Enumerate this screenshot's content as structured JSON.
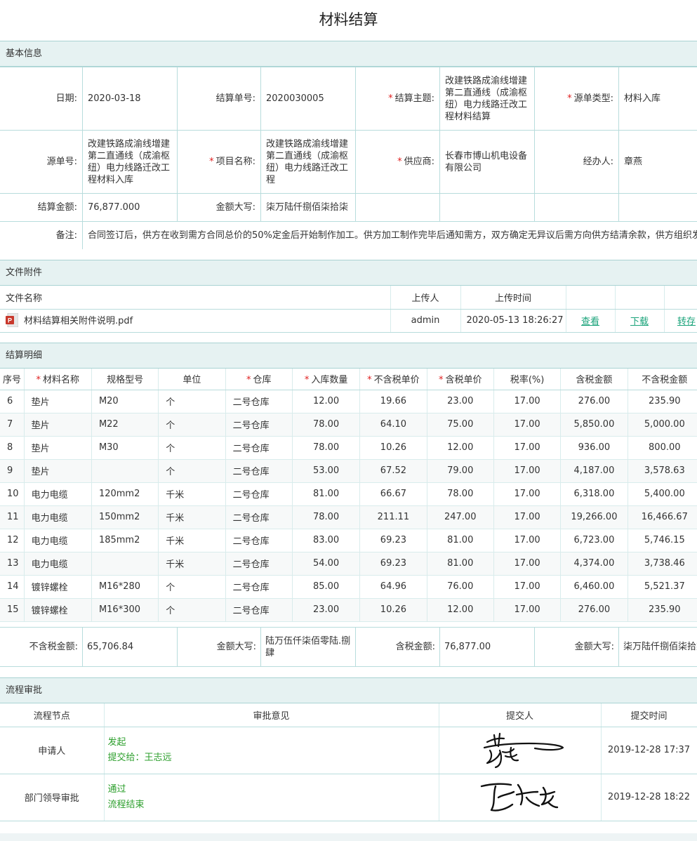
{
  "page": {
    "title": "材料结算"
  },
  "basic": {
    "header": "基本信息",
    "date_label": "日期:",
    "date": "2020-03-18",
    "no_label": "结算单号:",
    "no": "2020030005",
    "subject_label": "结算主题:",
    "subject": "改建铁路成渝线增建第二直通线（成渝枢纽）电力线路迁改工程材料结算",
    "source_type_label": "源单类型:",
    "source_type": "材料入库",
    "source_no_label": "源单号:",
    "source_no": "改建铁路成渝线增建第二直通线（成渝枢纽）电力线路迁改工程材料入库",
    "project_label": "项目名称:",
    "project": "改建铁路成渝线增建第二直通线（成渝枢纽）电力线路迁改工程",
    "supplier_label": "供应商:",
    "supplier": "长春市博山机电设备有限公司",
    "handler_label": "经办人:",
    "handler": "章燕",
    "amount_label": "结算金额:",
    "amount": "76,877.000",
    "amount_cn_label": "金额大写:",
    "amount_cn": "柒万陆仟捌佰柒拾柒",
    "remark_label": "备注:",
    "remark": "合同签订后，供方在收到需方合同总价的50%定金后开始制作加工。供方加工制作完毕后通知需方，双方确定无异议后需方向供方结清余款，供方组织发货"
  },
  "attachments": {
    "header": "文件附件",
    "col_name": "文件名称",
    "col_uploader": "上传人",
    "col_time": "上传时间",
    "file_name": "材料结算相关附件说明.pdf",
    "uploader": "admin",
    "time": "2020-05-13 18:26:27",
    "view": "查看",
    "download": "下载",
    "transfer": "转存",
    "icon": "pdf-icon"
  },
  "detail": {
    "header": "结算明细",
    "columns": [
      "序号",
      "材料名称",
      "规格型号",
      "单位",
      "仓库",
      "入库数量",
      "不含税单价",
      "含税单价",
      "税率(%)",
      "含税金额",
      "不含税金额"
    ],
    "rows": [
      [
        "6",
        "垫片",
        "M20",
        "个",
        "二号仓库",
        "12.00",
        "19.66",
        "23.00",
        "17.00",
        "276.00",
        "235.90"
      ],
      [
        "7",
        "垫片",
        "M22",
        "个",
        "二号仓库",
        "78.00",
        "64.10",
        "75.00",
        "17.00",
        "5,850.00",
        "5,000.00"
      ],
      [
        "8",
        "垫片",
        "M30",
        "个",
        "二号仓库",
        "78.00",
        "10.26",
        "12.00",
        "17.00",
        "936.00",
        "800.00"
      ],
      [
        "9",
        "垫片",
        "",
        "个",
        "二号仓库",
        "53.00",
        "67.52",
        "79.00",
        "17.00",
        "4,187.00",
        "3,578.63"
      ],
      [
        "10",
        "电力电缆",
        "120mm2",
        "千米",
        "二号仓库",
        "81.00",
        "66.67",
        "78.00",
        "17.00",
        "6,318.00",
        "5,400.00"
      ],
      [
        "11",
        "电力电缆",
        "150mm2",
        "千米",
        "二号仓库",
        "78.00",
        "211.11",
        "247.00",
        "17.00",
        "19,266.00",
        "16,466.67"
      ],
      [
        "12",
        "电力电缆",
        "185mm2",
        "千米",
        "二号仓库",
        "83.00",
        "69.23",
        "81.00",
        "17.00",
        "6,723.00",
        "5,746.15"
      ],
      [
        "13",
        "电力电缆",
        "",
        "千米",
        "二号仓库",
        "54.00",
        "69.23",
        "81.00",
        "17.00",
        "4,374.00",
        "3,738.46"
      ],
      [
        "14",
        "镀锌螺栓",
        "M16*280",
        "个",
        "二号仓库",
        "85.00",
        "64.96",
        "76.00",
        "17.00",
        "6,460.00",
        "5,521.37"
      ],
      [
        "15",
        "镀锌螺栓",
        "M16*300",
        "个",
        "二号仓库",
        "23.00",
        "10.26",
        "12.00",
        "17.00",
        "276.00",
        "235.90"
      ]
    ]
  },
  "totals": {
    "notax_label": "不含税金额:",
    "notax": "65,706.84",
    "notax_cn_label": "金额大写:",
    "notax_cn": "陆万伍仟柒佰零陆.捌肆",
    "tax_label": "含税金额:",
    "tax": "76,877.00",
    "tax_cn_label": "金额大写:",
    "tax_cn": "柒万陆仟捌佰柒拾柒"
  },
  "approval": {
    "header": "流程审批",
    "col_node": "流程节点",
    "col_opinion": "审批意见",
    "col_submitter": "提交人",
    "col_time": "提交时间",
    "rows": [
      {
        "node": "申请人",
        "opinion1": "发起",
        "opinion2": "提交给：王志远",
        "time": "2019-12-28 17:37"
      },
      {
        "node": "部门领导审批",
        "opinion1": "通过",
        "opinion2": "流程结束",
        "time": "2019-12-28 18:22"
      }
    ]
  },
  "colors": {
    "accent": "#1aa37a",
    "header_bg": "#e6f2f2",
    "border": "#b8dcdc",
    "required": "#e02020",
    "approve_text": "#2c9f2c"
  }
}
